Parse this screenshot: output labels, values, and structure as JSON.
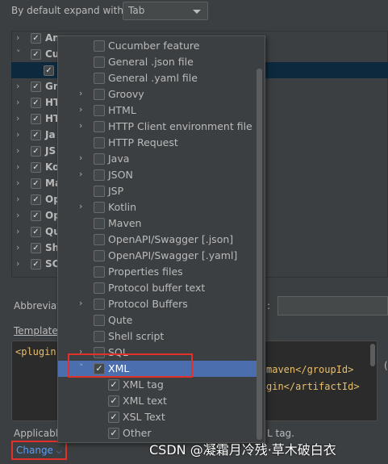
{
  "settings": {
    "expand_label": "By default expand with",
    "expand_value": "Tab",
    "abbreviation_label": "Abbreviati",
    "abbreviation_colon": ":",
    "template_label": "Template",
    "applicable_label": "Applicabl",
    "applicable_tail": "L tag.",
    "change_label": "Change",
    "right_edge_char": "("
  },
  "background_tree": [
    {
      "label": "An",
      "checked": true,
      "arrow": ">"
    },
    {
      "label": "Cu",
      "checked": true,
      "arrow": "v"
    },
    {
      "label": "",
      "checked": true,
      "arrow": ""
    },
    {
      "label": "Gr",
      "checked": true,
      "arrow": ">"
    },
    {
      "label": "HT",
      "checked": true,
      "arrow": ">"
    },
    {
      "label": "HT",
      "checked": true,
      "arrow": ">"
    },
    {
      "label": "Ja",
      "checked": true,
      "arrow": ">"
    },
    {
      "label": "JS",
      "checked": true,
      "arrow": ">"
    },
    {
      "label": "Ko",
      "checked": true,
      "arrow": ">"
    },
    {
      "label": "Ma",
      "checked": true,
      "arrow": ">"
    },
    {
      "label": "Op",
      "checked": true,
      "arrow": ">"
    },
    {
      "label": "Op",
      "checked": true,
      "arrow": ">"
    },
    {
      "label": "Qu",
      "checked": true,
      "arrow": ">"
    },
    {
      "label": "Sh",
      "checked": true,
      "arrow": ">"
    },
    {
      "label": "SC",
      "checked": true,
      "arrow": ">"
    }
  ],
  "editor": {
    "line1": "<plugin",
    "line2": "maven</groupId>",
    "line3": "gin</artifactId>"
  },
  "popup": {
    "items": [
      {
        "label": "Cucumber feature",
        "arrow": "",
        "checked": false,
        "level": 0
      },
      {
        "label": "General .json file",
        "arrow": "",
        "checked": false,
        "level": 0
      },
      {
        "label": "General .yaml file",
        "arrow": "",
        "checked": false,
        "level": 0
      },
      {
        "label": "Groovy",
        "arrow": ">",
        "checked": false,
        "level": 0
      },
      {
        "label": "HTML",
        "arrow": ">",
        "checked": false,
        "level": 0
      },
      {
        "label": "HTTP Client environment file",
        "arrow": ">",
        "checked": false,
        "level": 0
      },
      {
        "label": "HTTP Request",
        "arrow": "",
        "checked": false,
        "level": 0
      },
      {
        "label": "Java",
        "arrow": ">",
        "checked": false,
        "level": 0
      },
      {
        "label": "JSON",
        "arrow": ">",
        "checked": false,
        "level": 0
      },
      {
        "label": "JSP",
        "arrow": "",
        "checked": false,
        "level": 0
      },
      {
        "label": "Kotlin",
        "arrow": ">",
        "checked": false,
        "level": 0
      },
      {
        "label": "Maven",
        "arrow": "",
        "checked": false,
        "level": 0
      },
      {
        "label": "OpenAPI/Swagger [.json]",
        "arrow": "",
        "checked": false,
        "level": 0
      },
      {
        "label": "OpenAPI/Swagger [.yaml]",
        "arrow": "",
        "checked": false,
        "level": 0
      },
      {
        "label": "Properties files",
        "arrow": "",
        "checked": false,
        "level": 0
      },
      {
        "label": "Protocol buffer text",
        "arrow": "",
        "checked": false,
        "level": 0
      },
      {
        "label": "Protocol Buffers",
        "arrow": ">",
        "checked": false,
        "level": 0
      },
      {
        "label": "Qute",
        "arrow": "",
        "checked": false,
        "level": 0
      },
      {
        "label": "Shell script",
        "arrow": "",
        "checked": false,
        "level": 0
      },
      {
        "label": "SQL",
        "arrow": ">",
        "checked": false,
        "level": 0
      },
      {
        "label": "XML",
        "arrow": "v",
        "checked": true,
        "level": 0,
        "selected": true
      },
      {
        "label": "XML tag",
        "arrow": "",
        "checked": true,
        "level": 1
      },
      {
        "label": "XML text",
        "arrow": "",
        "checked": true,
        "level": 1
      },
      {
        "label": "XSL Text",
        "arrow": "",
        "checked": true,
        "level": 1
      },
      {
        "label": "Other",
        "arrow": "",
        "checked": true,
        "level": 1
      }
    ]
  },
  "watermark": "CSDN @凝霜月冷残·草木破白衣",
  "colors": {
    "background": "#3c3f41",
    "selection": "#4b6eaf",
    "highlight_box": "#e0312a",
    "link": "#589df6"
  }
}
